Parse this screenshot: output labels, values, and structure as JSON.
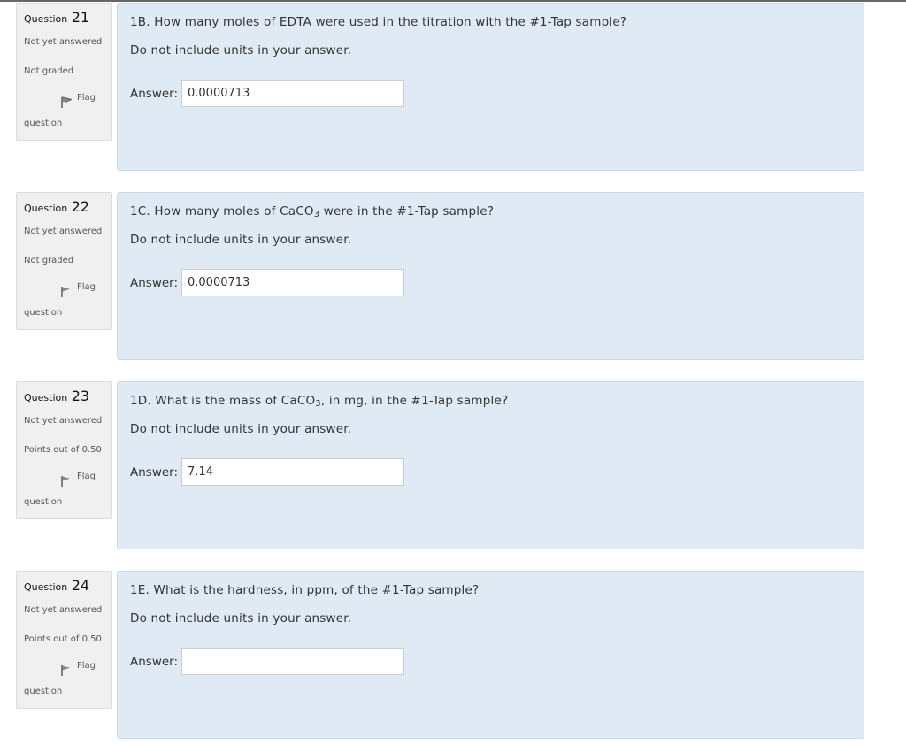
{
  "questions": [
    {
      "label": "Question",
      "number": "21",
      "state": "Not yet answered",
      "grade": "Not graded",
      "flag_label": "Flag",
      "flag_word": "question",
      "text_pre": "1B. How many moles of EDTA were used in the titration with the #1-Tap sample?",
      "text_sub": "",
      "text_post": "",
      "note": "Do not include units in your answer.",
      "answer_label": "Answer:",
      "answer_value": "0.0000713"
    },
    {
      "label": "Question",
      "number": "22",
      "state": "Not yet answered",
      "grade": "Not graded",
      "flag_label": "Flag",
      "flag_word": "question",
      "text_pre": "1C. How many moles of CaCO",
      "text_sub": "3",
      "text_post": " were in the #1-Tap sample?",
      "note": "Do not include units in your answer.",
      "answer_label": "Answer:",
      "answer_value": "0.0000713"
    },
    {
      "label": "Question",
      "number": "23",
      "state": "Not yet answered",
      "grade": "Points out of 0.50",
      "flag_label": "Flag",
      "flag_word": "question",
      "text_pre": "1D. What is the mass of CaCO",
      "text_sub": "3",
      "text_post": ", in mg, in the #1-Tap sample?",
      "note": "Do not include units in your answer.",
      "answer_label": "Answer:",
      "answer_value": "7.14"
    },
    {
      "label": "Question",
      "number": "24",
      "state": "Not yet answered",
      "grade": "Points out of 0.50",
      "flag_label": "Flag",
      "flag_word": "question",
      "text_pre": "1E. What is the hardness, in ppm, of the #1-Tap sample?",
      "text_sub": "",
      "text_post": "",
      "note": "Do not include units in your answer.",
      "answer_label": "Answer:",
      "answer_value": ""
    }
  ],
  "colors": {
    "content_bg": "#dfeaf5",
    "info_bg": "#f0f0f0"
  },
  "icons": {
    "flag": "flag-icon"
  }
}
